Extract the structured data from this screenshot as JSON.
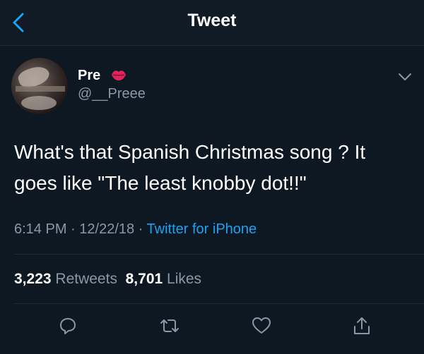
{
  "header": {
    "title": "Tweet"
  },
  "user": {
    "name": "Pre",
    "handle": "@__Preee"
  },
  "tweet": {
    "text": "What's that Spanish Christmas song ? It\ngoes like \"The least knobby dot!!\"",
    "time": "6:14 PM",
    "date": "12/22/18",
    "source": "Twitter for iPhone"
  },
  "stats": {
    "retweets_count": "3,223",
    "retweets_label": "Retweets",
    "likes_count": "8,701",
    "likes_label": "Likes"
  },
  "colors": {
    "background": "#0e1822",
    "accent": "#1da1f2",
    "secondary_text": "#8899a6",
    "lips": "#e0245e"
  },
  "icons": {
    "back": "chevron-left-icon",
    "menu": "chevron-down-icon",
    "reply": "reply-icon",
    "retweet": "retweet-icon",
    "like": "heart-icon",
    "share": "share-icon",
    "badge": "lips-icon"
  }
}
